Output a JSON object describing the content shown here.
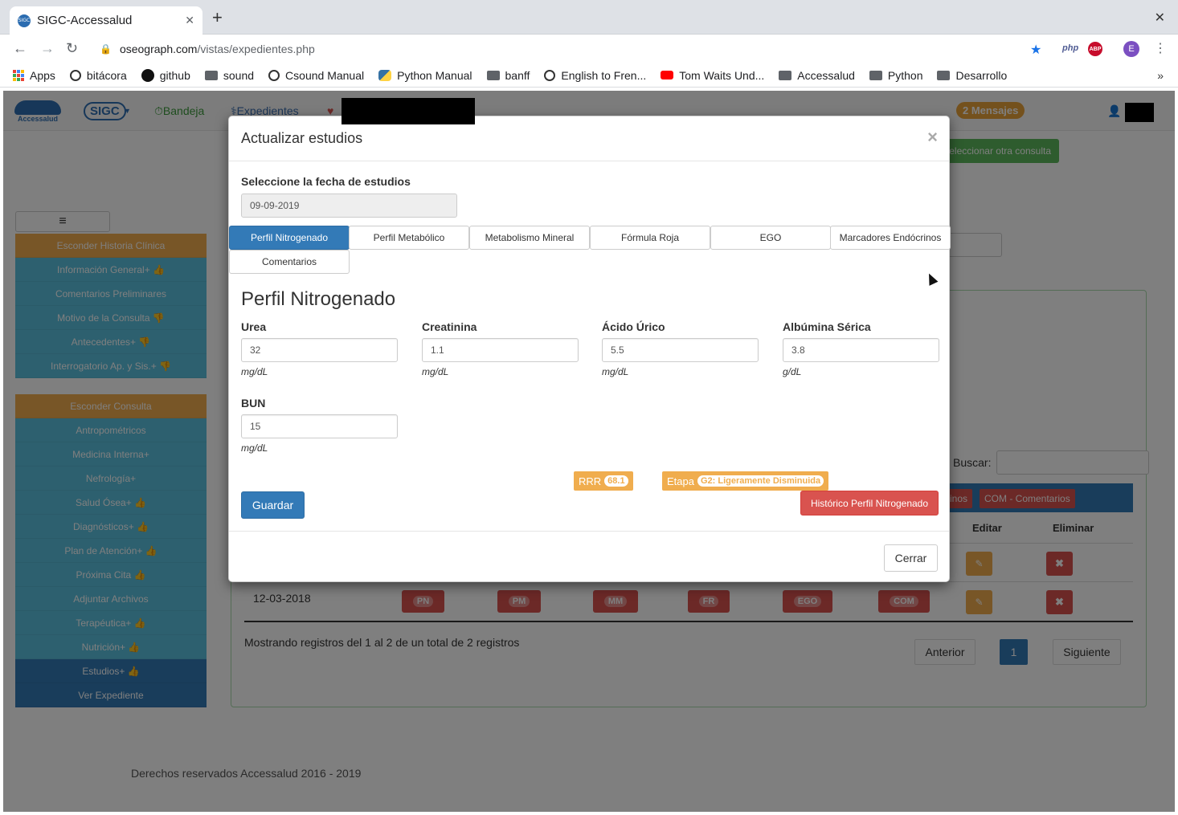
{
  "browser": {
    "tab_title": "SIGC-Accessalud",
    "favicon_text": "SIGC",
    "url_host": "oseograph.com",
    "url_path": "/vistas/expedientes.php",
    "profile_initial": "E",
    "ext_php": "php",
    "ext_abp": "ABP",
    "bookmarks": [
      "Apps",
      "bitácora",
      "github",
      "sound",
      "Csound Manual",
      "Python Manual",
      "banff",
      "English to Fren...",
      "Tom Waits Und...",
      "Accessalud",
      "Python",
      "Desarrollo"
    ],
    "bookmarks_more": "»"
  },
  "app": {
    "logo_text": "Accessalud",
    "sigc_logo": "SIGC",
    "nav": {
      "bandeja": "Bandeja",
      "expedientes": "Expedientes"
    },
    "mensajes": "2 Mensajes",
    "select_other": "eleccionar otra consulta",
    "sidebar": {
      "group1": [
        "Esconder Historia Clínica",
        "Información General+ 👍",
        "Comentarios Preliminares",
        "Motivo de la Consulta 👎",
        "Antecedentes+ 👎",
        "Interrogatorio Ap. y Sis.+ 👎"
      ],
      "group2": [
        "Esconder Consulta",
        "Antropométricos",
        "Medicina Interna+",
        "Nefrología+",
        "Salud Ósea+ 👍",
        "Diagnósticos+ 👍",
        "Plan de Atención+ 👍",
        "Próxima Cita 👍",
        "Adjuntar Archivos",
        "Terapéutica+ 👍",
        "Nutrición+ 👍",
        "Estudios+ 👍",
        "Ver Expediente"
      ]
    },
    "table": {
      "search_label": "Buscar:",
      "header_buttons": [
        "rinos",
        "COM - Comentarios"
      ],
      "col_editar": "Editar",
      "col_eliminar": "Eliminar",
      "row_date": "12-03-2018",
      "row_badges": [
        "PN",
        "PM",
        "MM",
        "FR",
        "EGO",
        "COM"
      ],
      "records_text": "Mostrando registros del 1 al 2 de un total de 2 registros"
    },
    "pager": {
      "prev": "Anterior",
      "page": "1",
      "next": "Siguiente"
    },
    "footer": "Derechos reservados Accessalud 2016 - 2019"
  },
  "modal": {
    "title": "Actualizar estudios",
    "close_x": "×",
    "date_label": "Seleccione la fecha de estudios",
    "date_value": "09-09-2019",
    "tabs": [
      "Perfil Nitrogenado",
      "Perfil Metabólico",
      "Metabolismo Mineral",
      "Fórmula Roja",
      "EGO",
      "Marcadores Endócrinos",
      "Comentarios"
    ],
    "section_title": "Perfil Nitrogenado",
    "fields": [
      {
        "label": "Urea",
        "value": "32",
        "unit": "mg/dL"
      },
      {
        "label": "Creatinina",
        "value": "1.1",
        "unit": "mg/dL"
      },
      {
        "label": "Ácido Úrico",
        "value": "5.5",
        "unit": "mg/dL"
      },
      {
        "label": "Albúmina Sérica",
        "value": "3.8",
        "unit": "g/dL"
      },
      {
        "label": "BUN",
        "value": "15",
        "unit": "mg/dL"
      }
    ],
    "rrr_label": "RRR",
    "rrr_value": "68.1",
    "etapa_label": "Etapa",
    "etapa_value": "G2: Ligeramente Disminuida",
    "save_button": "Guardar",
    "historico_button": "Histórico Perfil Nitrogenado",
    "close_button": "Cerrar"
  }
}
